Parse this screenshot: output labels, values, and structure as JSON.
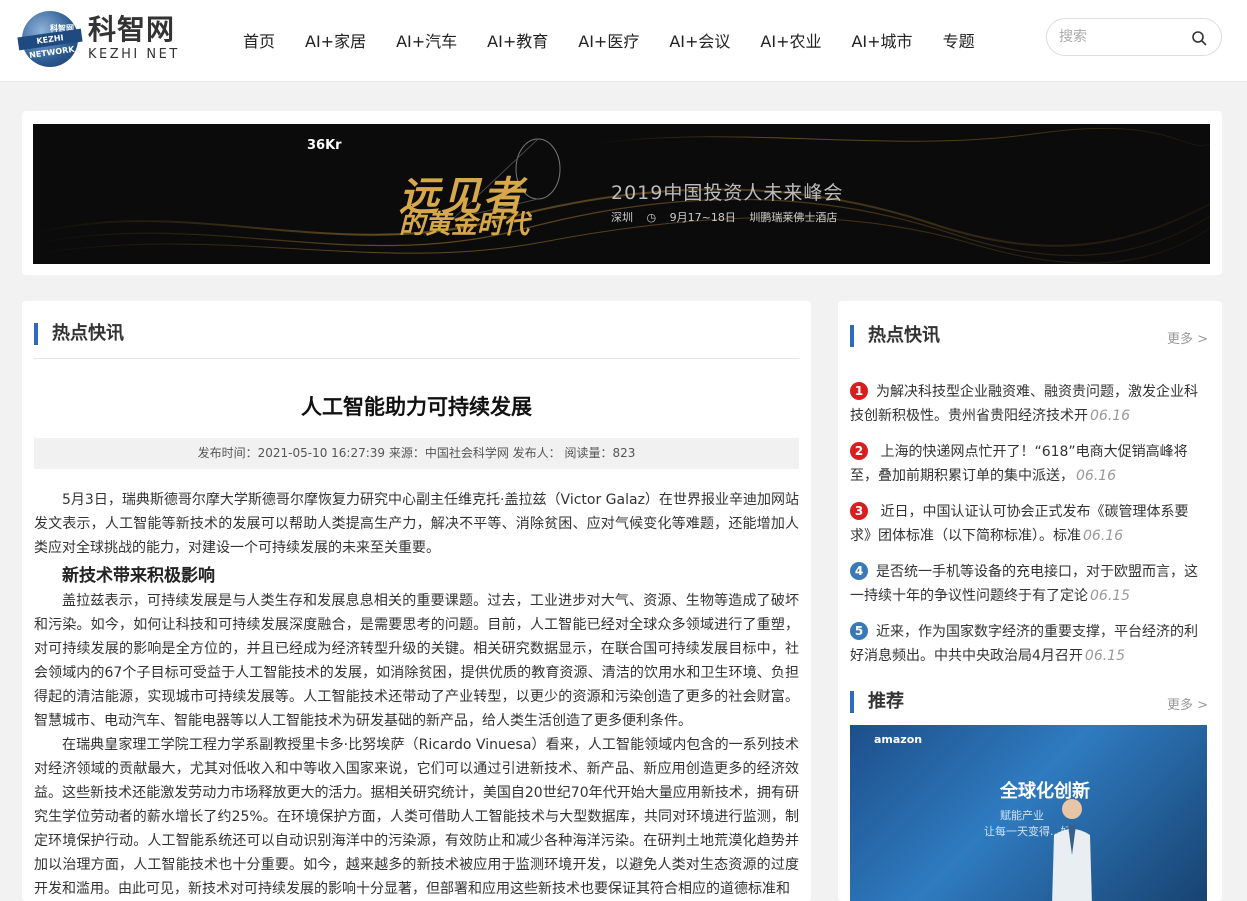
{
  "header": {
    "logo_cn": "科智网",
    "logo_en": "KEZHI NET",
    "logo_badge": "KEZHI NETWORK",
    "logo_badge_cn": "科智网",
    "nav": [
      "首页",
      "AI+家居",
      "AI+汽车",
      "AI+教育",
      "AI+医疗",
      "AI+会议",
      "AI+农业",
      "AI+城市",
      "专题"
    ],
    "search_placeholder": "搜索"
  },
  "banner": {
    "brand": "36Kr",
    "headline": "远见者",
    "subline": "的黄金时代",
    "event_title": "2019中国投资人未来峰会",
    "city": "深圳",
    "date": "9月17~18日",
    "venue": "圳鹏瑞莱佛士酒店"
  },
  "article": {
    "section": "热点快讯",
    "title": "人工智能助力可持续发展",
    "meta": "发布时间：2021-05-10 16:27:39  来源：中国社会科学网  发布人：  阅读量：823",
    "p1": "5月3日，瑞典斯德哥尔摩大学斯德哥尔摩恢复力研究中心副主任维克托·盖拉兹（Victor Galaz）在世界报业辛迪加网站发文表示，人工智能等新技术的发展可以帮助人类提高生产力，解决不平等、消除贫困、应对气候变化等难题，还能增加人类应对全球挑战的能力，对建设一个可持续发展的未来至关重要。",
    "h1": "新技术带来积极影响",
    "p2": "盖拉兹表示，可持续发展是与人类生存和发展息息相关的重要课题。过去，工业进步对大气、资源、生物等造成了破坏和污染。如今，如何让科技和可持续发展深度融合，是需要思考的问题。目前，人工智能已经对全球众多领域进行了重塑，对可持续发展的影响是全方位的，并且已经成为经济转型升级的关键。相关研究数据显示，在联合国可持续发展目标中，社会领域内的67个子目标可受益于人工智能技术的发展，如消除贫困，提供优质的教育资源、清洁的饮用水和卫生环境、负担得起的清洁能源，实现城市可持续发展等。人工智能技术还带动了产业转型，以更少的资源和污染创造了更多的社会财富。智慧城市、电动汽车、智能电器等以人工智能技术为研发基础的新产品，给人类生活创造了更多便利条件。",
    "p3": "在瑞典皇家理工学院工程力学系副教授里卡多·比努埃萨（Ricardo Vinuesa）看来，人工智能领域内包含的一系列技术对经济领域的贡献最大，尤其对低收入和中等收入国家来说，它们可以通过引进新技术、新产品、新应用创造更多的经济效益。这些新技术还能激发劳动力市场释放更大的活力。据相关研究统计，美国自20世纪70年代开始大量应用新技术，拥有研究生学位劳动者的薪水增长了约25%。在环境保护方面，人类可借助人工智能技术与大型数据库，共同对环境进行监测，制定环境保护行动。人工智能系统还可以自动识别海洋中的污染源，有效防止和减少各种海洋污染。在研判土地荒漠化趋势并加以治理方面，人工智能技术也十分重要。如今，越来越多的新技术被应用于监测环境开发，以避免人类对生态资源的过度开发和滥用。由此可见，新技术对可持续发展的影响十分显著，但部署和应用这些新技术也要保证其符合相应的道德标准和"
  },
  "sidebar": {
    "hot_title": "热点快讯",
    "more": "更多 >",
    "hot_items": [
      {
        "num": "1",
        "text": "为解决科技型企业融资难、融资贵问题，激发企业科技创新积极性。贵州省贵阳经济技术开",
        "date": "06.16",
        "color": "red"
      },
      {
        "num": "2",
        "text": " 上海的快递网点忙开了！“618”电商大促销高峰将至，叠加前期积累订单的集中派送，",
        "date": "06.16",
        "color": "red"
      },
      {
        "num": "3",
        "text": " 近日，中国认证认可协会正式发布《碳管理体系要求》团体标准（以下简称标准）。标准",
        "date": "06.16",
        "color": "red"
      },
      {
        "num": "4",
        "text": "是否统一手机等设备的充电接口，对于欧盟而言，这一持续十年的争议性问题终于有了定论",
        "date": "06.15",
        "color": "blue"
      },
      {
        "num": "5",
        "text": "近来，作为国家数字经济的重要支撑，平台经济的利好消息频出。中共中央政治局4月召开",
        "date": "06.15",
        "color": "blue"
      }
    ],
    "rec_title": "推荐",
    "rec_more": "更多 >",
    "rec_brand": "amazon",
    "rec_big": "全球化创新",
    "rec_small1": "赋能产业",
    "rec_small2": "让每一天变得...好"
  },
  "colors": {
    "accent": "#2a6ebb",
    "rank_red": "#d81e1e",
    "rank_blue": "#3a79b8",
    "banner_gold": "#d7a84a"
  }
}
